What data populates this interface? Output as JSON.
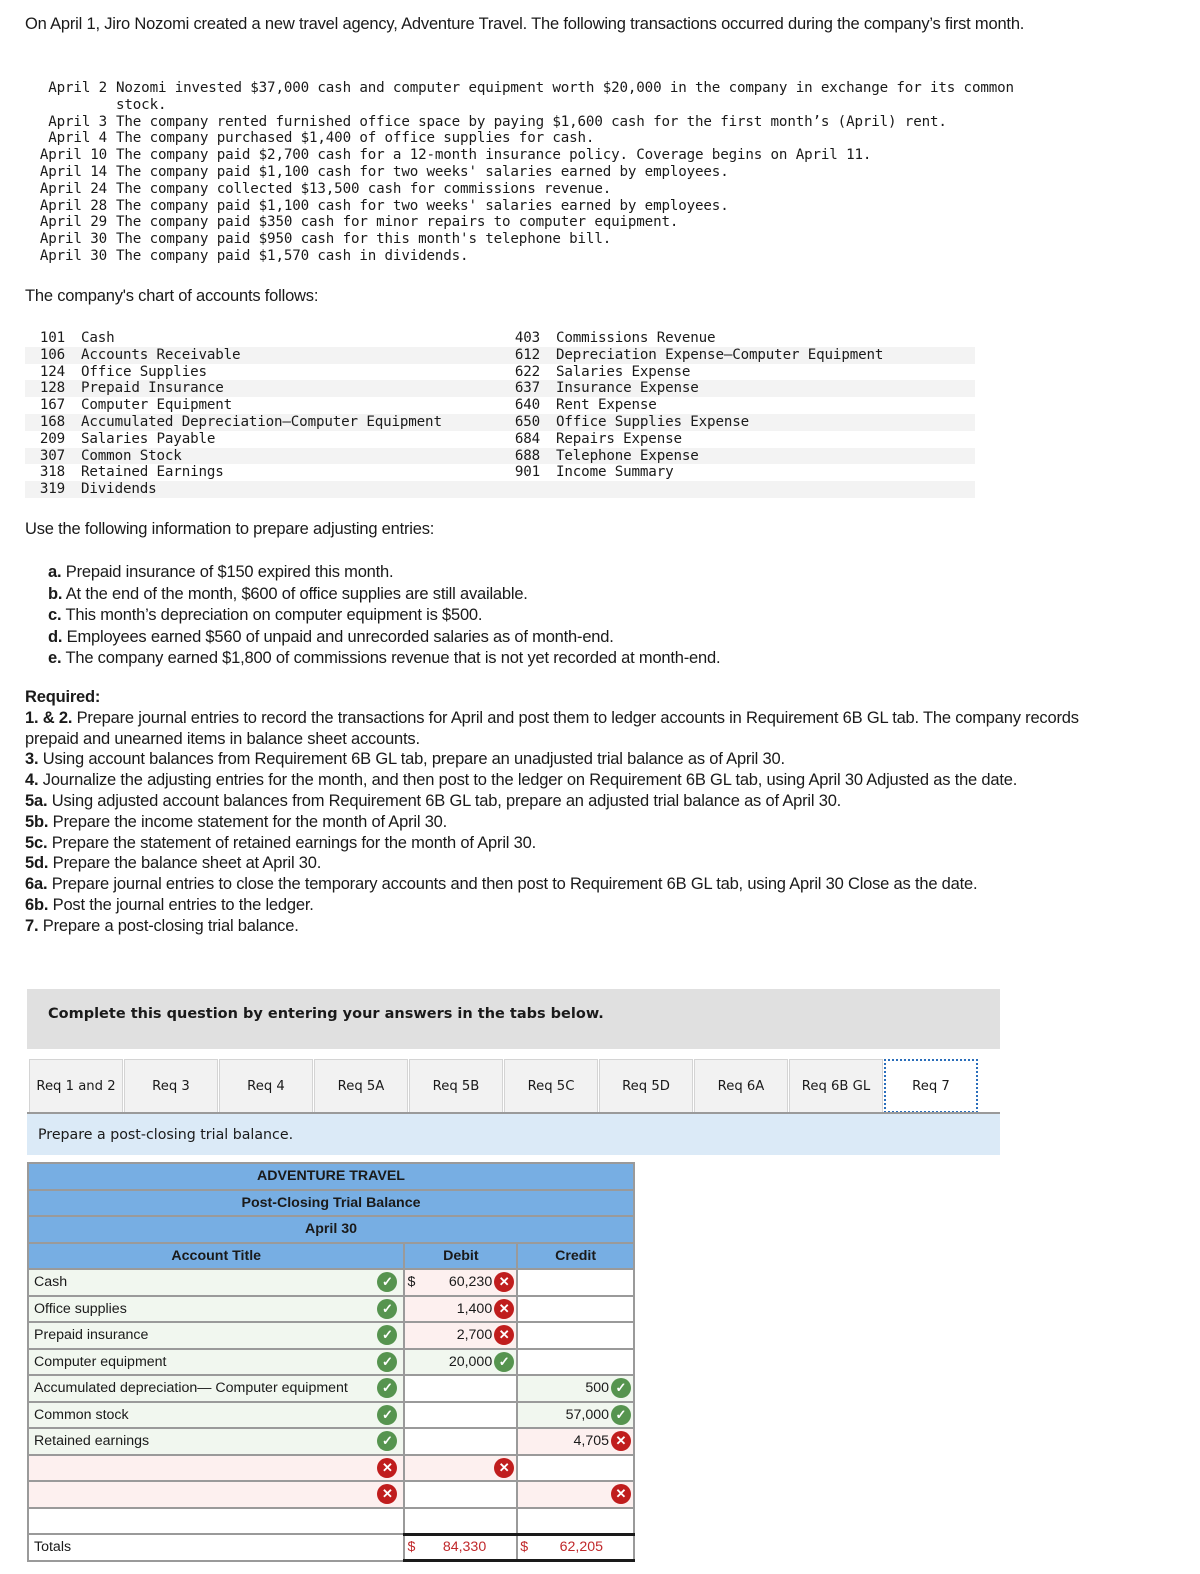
{
  "intro": "On April 1, Jiro Nozomi created a new travel agency, Adventure Travel. The following transactions occurred during the company’s first month.",
  "transactions": [
    {
      "date": "April 2",
      "text": "Nozomi invested $37,000 cash and computer equipment worth $20,000 in the company in exchange for its common\nstock."
    },
    {
      "date": "April 3",
      "text": "The company rented furnished office space by paying $1,600 cash for the first month’s (April) rent."
    },
    {
      "date": "April 4",
      "text": "The company purchased $1,400 of office supplies for cash."
    },
    {
      "date": "April 10",
      "text": "The company paid $2,700 cash for a 12-month insurance policy. Coverage begins on April 11."
    },
    {
      "date": "April 14",
      "text": "The company paid $1,100 cash for two weeks' salaries earned by employees."
    },
    {
      "date": "April 24",
      "text": "The company collected $13,500 cash for commissions revenue."
    },
    {
      "date": "April 28",
      "text": "The company paid $1,100 cash for two weeks' salaries earned by employees."
    },
    {
      "date": "April 29",
      "text": "The company paid $350 cash for minor repairs to computer equipment."
    },
    {
      "date": "April 30",
      "text": "The company paid $950 cash for this month's telephone bill."
    },
    {
      "date": "April 30",
      "text": "The company paid $1,570 cash in dividends."
    }
  ],
  "chart_of_accounts_label": "The company's chart of accounts follows:",
  "chart_of_accounts": {
    "left": [
      {
        "num": "101",
        "name": "Cash"
      },
      {
        "num": "106",
        "name": "Accounts Receivable"
      },
      {
        "num": "124",
        "name": "Office Supplies"
      },
      {
        "num": "128",
        "name": "Prepaid Insurance"
      },
      {
        "num": "167",
        "name": "Computer Equipment"
      },
      {
        "num": "168",
        "name": "Accumulated Depreciation—Computer Equipment"
      },
      {
        "num": "209",
        "name": "Salaries Payable"
      },
      {
        "num": "307",
        "name": "Common Stock"
      },
      {
        "num": "318",
        "name": "Retained Earnings"
      },
      {
        "num": "319",
        "name": "Dividends"
      }
    ],
    "right": [
      {
        "num": "403",
        "name": "Commissions Revenue"
      },
      {
        "num": "612",
        "name": "Depreciation Expense—Computer Equipment"
      },
      {
        "num": "622",
        "name": "Salaries Expense"
      },
      {
        "num": "637",
        "name": "Insurance Expense"
      },
      {
        "num": "640",
        "name": "Rent Expense"
      },
      {
        "num": "650",
        "name": "Office Supplies Expense"
      },
      {
        "num": "684",
        "name": "Repairs Expense"
      },
      {
        "num": "688",
        "name": "Telephone Expense"
      },
      {
        "num": "901",
        "name": "Income Summary"
      },
      {
        "num": "",
        "name": ""
      }
    ]
  },
  "adjusting_label": "Use the following information to prepare adjusting entries:",
  "adjusting_items": [
    {
      "letter": "a.",
      "text": "Prepaid insurance of $150 expired this month."
    },
    {
      "letter": "b.",
      "text": "At the end of the month, $600 of office supplies are still available."
    },
    {
      "letter": "c.",
      "text": "This month’s depreciation on computer equipment is $500."
    },
    {
      "letter": "d.",
      "text": "Employees earned $560 of unpaid and unrecorded salaries as of month-end."
    },
    {
      "letter": "e.",
      "text": "The company earned $1,800 of commissions revenue that is not yet recorded at month-end."
    }
  ],
  "required": {
    "heading": "Required:",
    "items": [
      {
        "num": "1. & 2.",
        "text": "Prepare journal entries to record the transactions for April and post them to ledger accounts in Requirement 6B GL tab. The company records prepaid and unearned items in balance sheet accounts."
      },
      {
        "num": "3.",
        "text": "Using account balances from Requirement 6B GL tab, prepare an unadjusted trial balance as of April 30."
      },
      {
        "num": "4.",
        "text": "Journalize the adjusting entries for the month, and then post to the ledger on Requirement 6B GL tab, using April 30 Adjusted as the date."
      },
      {
        "num": "5a.",
        "text": "Using adjusted account balances from Requirement 6B GL tab, prepare an adjusted trial balance as of April 30."
      },
      {
        "num": "5b.",
        "text": "Prepare the income statement for the month of April 30."
      },
      {
        "num": "5c.",
        "text": "Prepare the statement of retained earnings for the month of April 30."
      },
      {
        "num": "5d.",
        "text": "Prepare the balance sheet at April 30."
      },
      {
        "num": "6a.",
        "text": "Prepare journal entries to close the temporary accounts and then post to Requirement 6B GL tab, using April 30 Close as the date."
      },
      {
        "num": "6b.",
        "text": "Post the journal entries to the ledger."
      },
      {
        "num": "7.",
        "text": "Prepare a post-closing trial balance."
      }
    ]
  },
  "complete_bar": "Complete this question by entering your answers in the tabs below.",
  "tabs": [
    {
      "label": "Req 1 and 2",
      "active": false
    },
    {
      "label": "Req 3",
      "active": false
    },
    {
      "label": "Req 4",
      "active": false
    },
    {
      "label": "Req 5A",
      "active": false
    },
    {
      "label": "Req 5B",
      "active": false
    },
    {
      "label": "Req 5C",
      "active": false
    },
    {
      "label": "Req 5D",
      "active": false
    },
    {
      "label": "Req 6A",
      "active": false
    },
    {
      "label": "Req 6B GL",
      "active": false
    },
    {
      "label": "Req 7",
      "active": true
    }
  ],
  "instruction": "Prepare a post-closing trial balance.",
  "trial_balance": {
    "company": "ADVENTURE TRAVEL",
    "title": "Post-Closing Trial Balance",
    "date": "April 30",
    "col_account": "Account Title",
    "col_debit": "Debit",
    "col_credit": "Credit",
    "rows": [
      {
        "account": "Cash",
        "account_status": "check",
        "debit": "60,230",
        "debit_dollar": true,
        "debit_status": "cross",
        "credit": "",
        "credit_status": ""
      },
      {
        "account": "Office supplies",
        "account_status": "check",
        "debit": "1,400",
        "debit_dollar": false,
        "debit_status": "cross",
        "credit": "",
        "credit_status": ""
      },
      {
        "account": "Prepaid insurance",
        "account_status": "check",
        "debit": "2,700",
        "debit_dollar": false,
        "debit_status": "cross",
        "credit": "",
        "credit_status": ""
      },
      {
        "account": "Computer equipment",
        "account_status": "check",
        "debit": "20,000",
        "debit_dollar": false,
        "debit_status": "check",
        "credit": "",
        "credit_status": ""
      },
      {
        "account": "Accumulated depreciation— Computer equipment",
        "account_status": "check",
        "debit": "",
        "debit_dollar": false,
        "debit_status": "",
        "credit": "500",
        "credit_status": "check"
      },
      {
        "account": "Common stock",
        "account_status": "check",
        "debit": "",
        "debit_dollar": false,
        "debit_status": "",
        "credit": "57,000",
        "credit_status": "check"
      },
      {
        "account": "Retained earnings",
        "account_status": "check",
        "debit": "",
        "debit_dollar": false,
        "debit_status": "",
        "credit": "4,705",
        "credit_status": "cross"
      },
      {
        "account": "",
        "account_status": "cross",
        "debit": "",
        "debit_dollar": false,
        "debit_status": "cross",
        "credit": "",
        "credit_status": ""
      },
      {
        "account": "",
        "account_status": "cross",
        "debit": "",
        "debit_dollar": false,
        "debit_status": "",
        "credit": "",
        "credit_status": "cross"
      },
      {
        "account": "",
        "account_status": "",
        "debit": "",
        "debit_dollar": false,
        "debit_status": "",
        "credit": "",
        "credit_status": ""
      }
    ],
    "totals_label": "Totals",
    "total_debit": "84,330",
    "total_credit": "62,205",
    "currency": "$"
  },
  "icons": {
    "check": "✓",
    "cross": "✕"
  },
  "colors": {
    "header_blue": "#77aee3",
    "check_green": "#56944f",
    "cross_red": "#c01d1d",
    "instruction_bg": "#dbeaf7",
    "total_red": "#c0282b"
  }
}
